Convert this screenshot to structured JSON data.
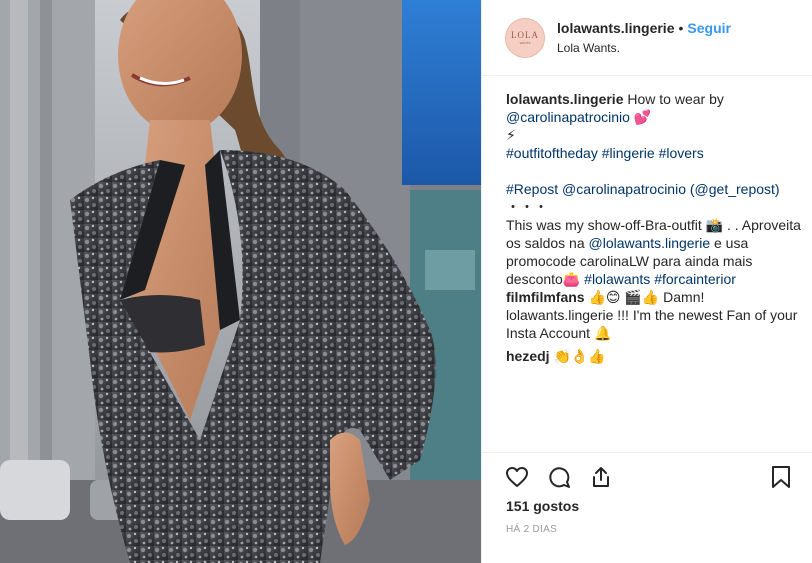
{
  "header": {
    "avatar_text": "LOLA",
    "avatar_sub": "WANTS",
    "username": "lolawants.lingerie",
    "separator": "•",
    "follow_label": "Seguir",
    "location": "Lola Wants."
  },
  "caption": {
    "username": "lolawants.lingerie",
    "text_1": " How to wear by",
    "mention_1": "@carolinapatrocinio",
    "emoji_1": " 💕",
    "emoji_2": "⚡",
    "hashtag_1": "#outfitoftheday",
    "hashtag_2": "#lingerie",
    "hashtag_3": "#lovers",
    "repost_tag": "#Repost",
    "mention_2": "@carolinapatrocinio",
    "repost_via": "(@get_repost)",
    "dots": "・・・",
    "text_2": "This was my show-off-Bra-outfit 📸 . . Aproveita os saldos na ",
    "mention_3": "@lolawants.lingerie",
    "text_3": " e usa promocode carolinaLW para ainda mais desconto👛 ",
    "hashtag_4": "#lolawants",
    "hashtag_5": "#forcainterior"
  },
  "comments": [
    {
      "username": "filmfilmfans",
      "text": " 👍😊 🎬👍 Damn! lolawants.lingerie !!! I'm the newest Fan of your Insta Account 🔔"
    },
    {
      "username": "hezedj",
      "text": " 👏👌👍"
    }
  ],
  "actions": {
    "icons": [
      "heart-icon",
      "comment-icon",
      "share-icon",
      "bookmark-icon"
    ]
  },
  "likes": "151 gostos",
  "timestamp": "HÁ 2 DIAS",
  "colors": {
    "accent": "#3897f0",
    "link": "#003569",
    "text": "#262626",
    "muted": "#999999",
    "divider": "#efefef"
  }
}
